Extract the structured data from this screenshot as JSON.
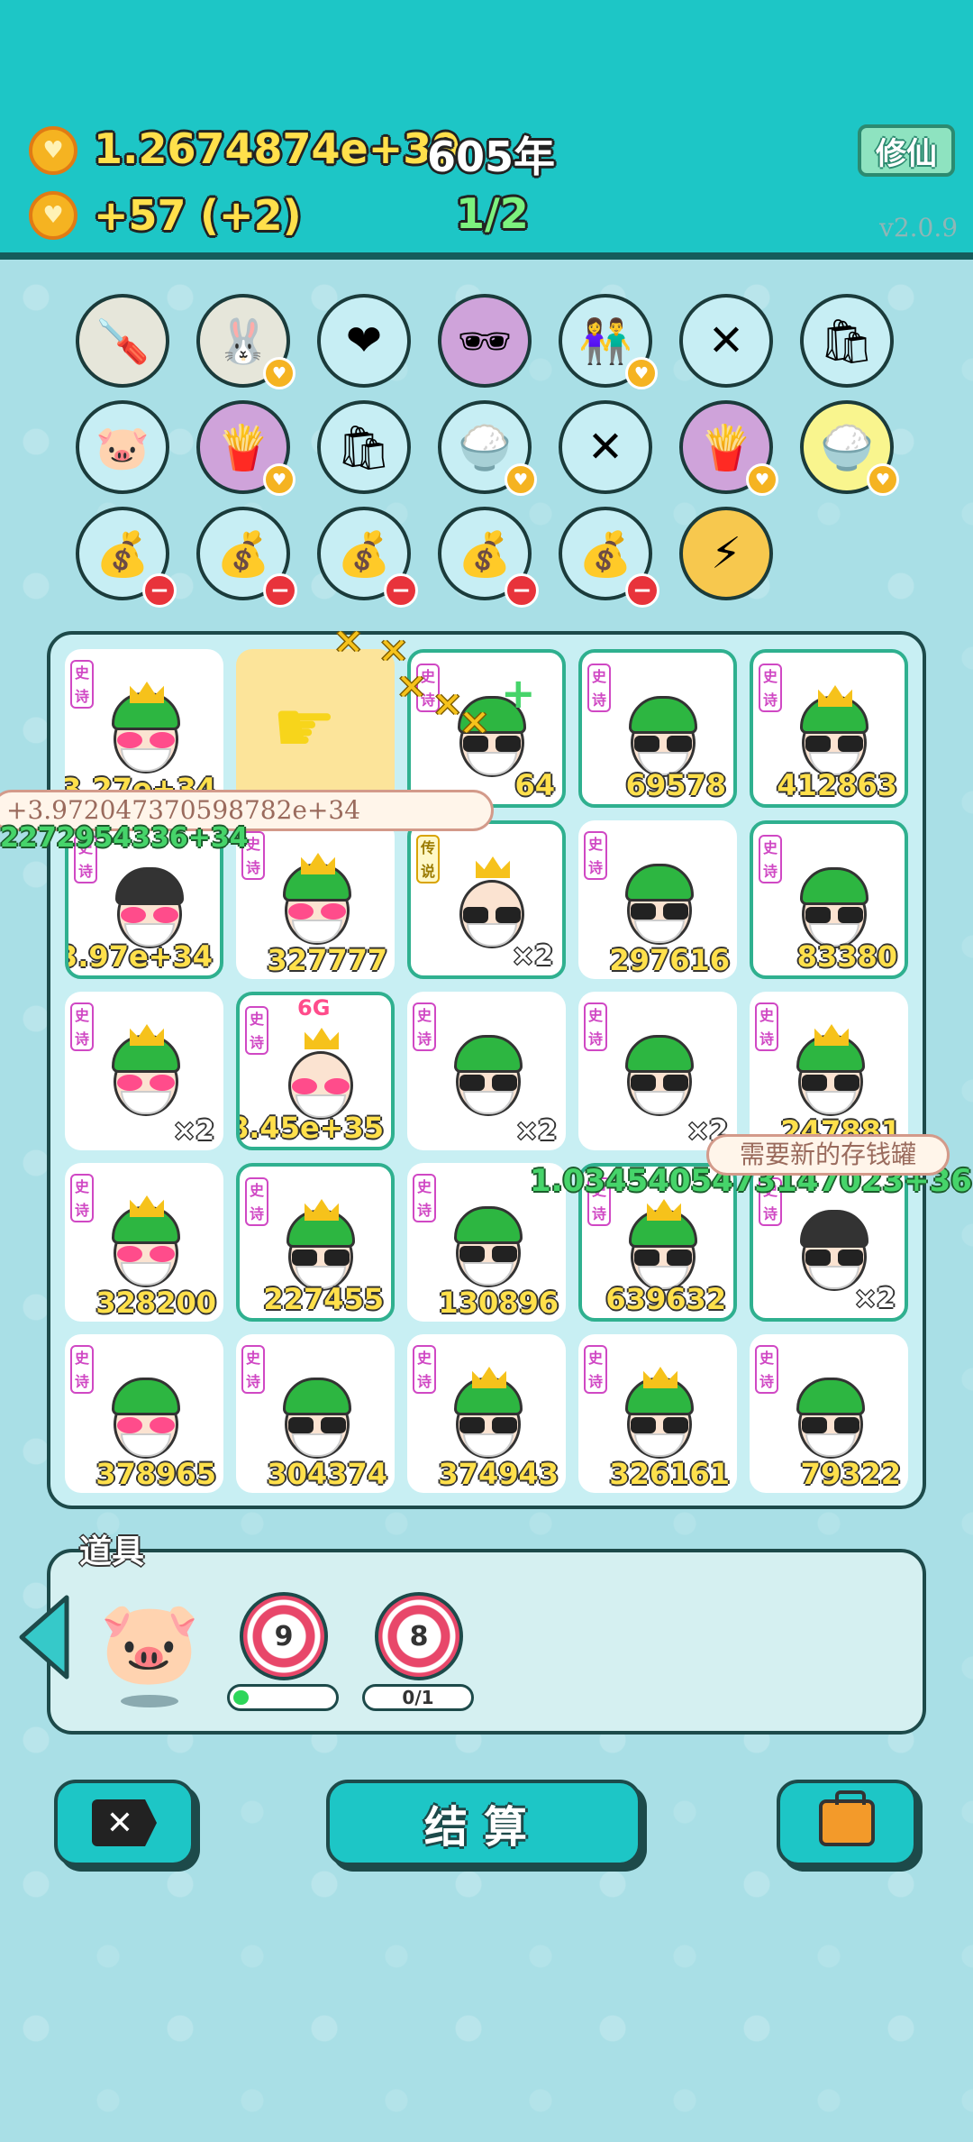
{
  "header": {
    "total_coins": "1.2674874e+39",
    "years": "605年",
    "income": "+57",
    "income_bonus": "(+2)",
    "stage": "1/2",
    "xiuxian_label": "修仙",
    "version": "v2.0.9"
  },
  "floating": {
    "toast_text": "+3.972047370598782e+34",
    "left_number": "2272954336+34",
    "board_number": "1.0345405473147023+36",
    "bubble_text": "需要新的存钱罐"
  },
  "items": [
    {
      "icon": "screwdriver-icon",
      "glyph": "🪛"
    },
    {
      "icon": "rabbit-icon",
      "glyph": "🐰"
    },
    {
      "icon": "heart-fan-icon",
      "glyph": "❤"
    },
    {
      "icon": "eyepatch-icon",
      "glyph": "🕶"
    },
    {
      "icon": "couple-icon",
      "glyph": "👫"
    },
    {
      "icon": "sticks-icon",
      "glyph": "✕"
    },
    {
      "icon": "recycle-bag-icon",
      "glyph": "🛍"
    },
    {
      "icon": "piggy-bank-icon",
      "glyph": "🐷"
    },
    {
      "icon": "fries-icon",
      "glyph": "🍟"
    },
    {
      "icon": "recycle-bag-icon",
      "glyph": "🛍"
    },
    {
      "icon": "rice-bowl-icon",
      "glyph": "🍚"
    },
    {
      "icon": "sticks-icon",
      "glyph": "✕"
    },
    {
      "icon": "fries-icon",
      "glyph": "🍟"
    },
    {
      "icon": "rice-bowl-icon",
      "glyph": "🍚"
    },
    {
      "icon": "sack-icon",
      "glyph": "💰"
    },
    {
      "icon": "sack-icon",
      "glyph": "💰"
    },
    {
      "icon": "sack-icon",
      "glyph": "💰"
    },
    {
      "icon": "sack-icon",
      "glyph": "💰"
    },
    {
      "icon": "sack-icon",
      "glyph": "💰"
    },
    {
      "icon": "lightning-icon",
      "glyph": "⚡"
    }
  ],
  "tags": {
    "epic": "史诗",
    "legend": "传说"
  },
  "board": {
    "r0": [
      "3.27e+34",
      "",
      "64",
      "69578",
      "412863"
    ],
    "r1": [
      "3.97e+34",
      "327777",
      "×2",
      "297616",
      "83380"
    ],
    "r2": [
      "×2",
      "8.45e+35",
      "×2",
      "×2",
      "247881"
    ],
    "r3": [
      "328200",
      "227455",
      "130896",
      "639632",
      "×2"
    ],
    "r4": [
      "378965",
      "304374",
      "374943",
      "326161",
      "79322"
    ],
    "cell_badge": "6G"
  },
  "tools": {
    "label": "道具",
    "target1": "9",
    "target2": "8",
    "target1_progress": 0.15,
    "target2_progress_text": "0/1"
  },
  "buttons": {
    "cancel_glyph": "✕",
    "settle_label": "结算"
  },
  "colors": {
    "header_bg": "#1dc6c6",
    "accent_gold": "#ffe04b",
    "epic_tag": "#d048c4"
  }
}
